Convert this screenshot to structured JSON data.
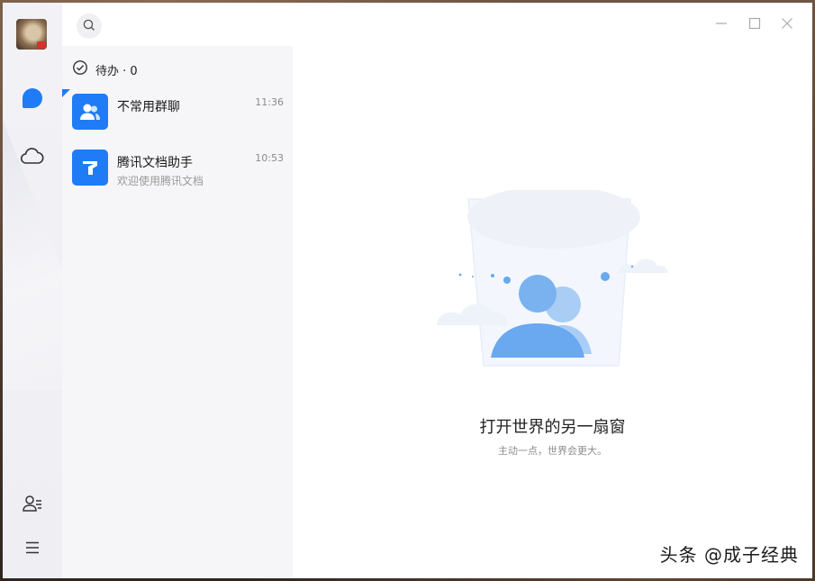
{
  "search": {
    "icon": "search-icon"
  },
  "todo": {
    "label": "待办 · 0",
    "icon": "check-circle-icon"
  },
  "conversations": [
    {
      "name": "不常用群聊",
      "time": "11:36",
      "preview": "",
      "icon": "group-icon"
    },
    {
      "name": "腾讯文档助手",
      "time": "10:53",
      "preview": "欢迎使用腾讯文档",
      "icon": "tencent-docs-icon"
    }
  ],
  "empty_state": {
    "title": "打开世界的另一扇窗",
    "subtitle": "主动一点，世界会更大。"
  },
  "watermark": "头条 @成子经典",
  "colors": {
    "accent": "#1f7cf6",
    "rail_bg": "#f2f2f6",
    "list_bg": "#f6f6f8"
  }
}
